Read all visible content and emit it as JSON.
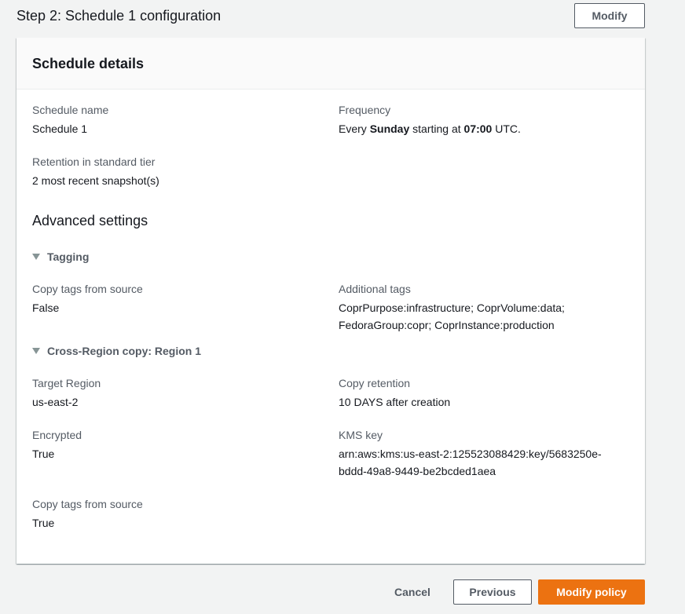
{
  "step": {
    "title": "Step 2: Schedule 1 configuration",
    "modify_label": "Modify"
  },
  "panel": {
    "title": "Schedule details",
    "schedule_name": {
      "label": "Schedule name",
      "value": "Schedule 1"
    },
    "frequency": {
      "label": "Frequency",
      "prefix": "Every ",
      "day": "Sunday",
      "middle": " starting at ",
      "time": "07:00",
      "suffix": " UTC."
    },
    "retention": {
      "label": "Retention in standard tier",
      "value": "2 most recent snapshot(s)"
    },
    "advanced": {
      "title": "Advanced settings",
      "tagging": {
        "label": "Tagging",
        "copy_tags": {
          "label": "Copy tags from source",
          "value": "False"
        },
        "additional_tags": {
          "label": "Additional tags",
          "line1": "CoprPurpose:infrastructure; CoprVolume:data;",
          "line2": "FedoraGroup:copr; CoprInstance:production"
        }
      },
      "cross_region": {
        "label": "Cross-Region copy: Region 1",
        "target_region": {
          "label": "Target Region",
          "value": "us-east-2"
        },
        "copy_retention": {
          "label": "Copy retention",
          "value": "10 DAYS after creation"
        },
        "encrypted": {
          "label": "Encrypted",
          "value": "True"
        },
        "kms_key": {
          "label": "KMS key",
          "line1": "arn:aws:kms:us-east-2:125523088429:key/5683250e-",
          "line2": "bddd-49a8-9449-be2bcded1aea"
        },
        "copy_tags": {
          "label": "Copy tags from source",
          "value": "True"
        }
      }
    }
  },
  "footer": {
    "cancel_label": "Cancel",
    "previous_label": "Previous",
    "modify_policy_label": "Modify policy"
  },
  "colors": {
    "primary": "#ec7211",
    "text": "#16191f",
    "label": "#545b64",
    "background": "#f2f3f3"
  },
  "icons": {
    "expander": "caret-down-icon"
  }
}
